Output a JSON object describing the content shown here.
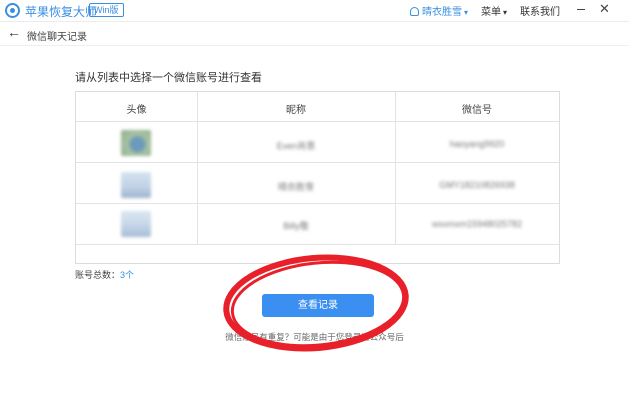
{
  "titlebar": {
    "app_name": "苹果恢复大师",
    "version_badge": "Win版",
    "user_name": "晴衣胜雪",
    "user_caret": "▾",
    "menu_label": "菜单",
    "menu_caret": "▾",
    "contact_label": "联系我们",
    "close_glyph": "✕"
  },
  "subbar": {
    "back_glyph": "←",
    "title": "微信聊天记录"
  },
  "main": {
    "instruction": "请从列表中选择一个微信账号进行查看",
    "table": {
      "headers": [
        "头像",
        "昵称",
        "微信号"
      ],
      "rows": [
        {
          "nickname": "Even肖恩",
          "wechat_id": "haoyang9920"
        },
        {
          "nickname": "晴衣胜雪",
          "wechat_id": "GMY18210826938"
        },
        {
          "nickname": "Billy敬",
          "wechat_id": "wxxmxm15948025782"
        }
      ]
    },
    "count_label": "账号总数：",
    "count_value": "3个",
    "view_button": "查看记录",
    "hint": "微信账号有重复？可能是由于您登录过公众号后"
  },
  "colors": {
    "accent": "#3a8fe0",
    "button": "#3b8ff0",
    "annotation": "#e8202a"
  }
}
